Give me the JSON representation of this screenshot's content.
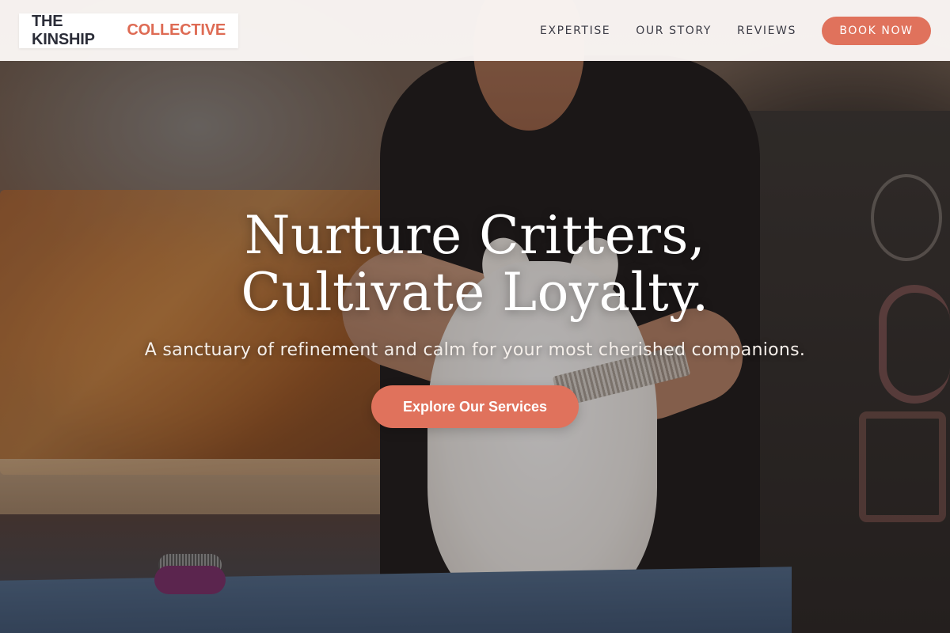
{
  "brand": {
    "name_main": "THE KINSHIP",
    "name_accent": "COLLECTIVE"
  },
  "nav": {
    "items": [
      {
        "label": "EXPERTISE"
      },
      {
        "label": "OUR STORY"
      },
      {
        "label": "REVIEWS"
      }
    ],
    "cta_label": "BOOK NOW"
  },
  "hero": {
    "title_line1": "Nurture Critters,",
    "title_line2": "Cultivate Loyalty.",
    "subtitle": "A sanctuary of refinement and calm for your most cherished companions.",
    "cta_label": "Explore Our Services",
    "background": "groomer-with-white-pomeranian-photo"
  },
  "colors": {
    "accent": "#e0725c",
    "logo_accent": "#de6b54",
    "nav_text": "#3c3c46",
    "header_bg": "#fcf8f6"
  }
}
